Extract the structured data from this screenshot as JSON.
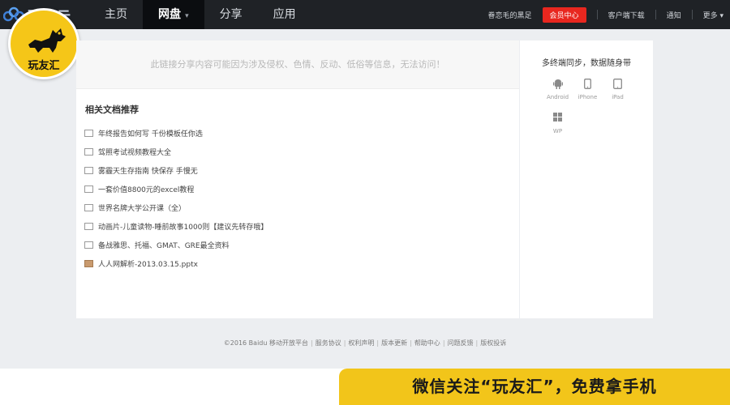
{
  "header": {
    "brand": "百度云",
    "nav": [
      "主页",
      "网盘",
      "分享",
      "应用"
    ],
    "username": "眷恋毛的黑足",
    "vip_button": "会员中心",
    "client_download": "客户端下载",
    "notifications": "通知",
    "more": "更多"
  },
  "badge": {
    "label": "玩友汇"
  },
  "notice": "此链接分享内容可能因为涉及侵权、色情、反动、低俗等信息，无法访问！",
  "related": {
    "title": "相关文档推荐",
    "items": [
      "年终报告如何写 千份模板任你选",
      "驾照考试视频教程大全",
      "雾霾天生存指南 快保存 手慢无",
      "一套价值8800元的excel教程",
      "世界名牌大学公开课（全）",
      "动画片-儿童读物-睡前故事1000则【建议先转存哦】",
      "备战雅思、托福、GMAT、GRE最全资料",
      "人人网解析-2013.03.15.pptx"
    ]
  },
  "sync": {
    "title": "多终端同步，数据随身带",
    "platforms": [
      "Android",
      "iPhone",
      "iPad",
      "WP"
    ]
  },
  "footer": {
    "copyright": "©2016 Baidu",
    "links": [
      "移动开放平台",
      "服务协议",
      "权利声明",
      "版本更新",
      "帮助中心",
      "问题反馈",
      "版权投诉"
    ]
  },
  "promo": "微信关注“玩友汇”，免费拿手机",
  "colors": {
    "topbar": "#1f2226",
    "vip": "#e8271f",
    "promo": "#f2c51a",
    "badge": "#f5c618"
  }
}
